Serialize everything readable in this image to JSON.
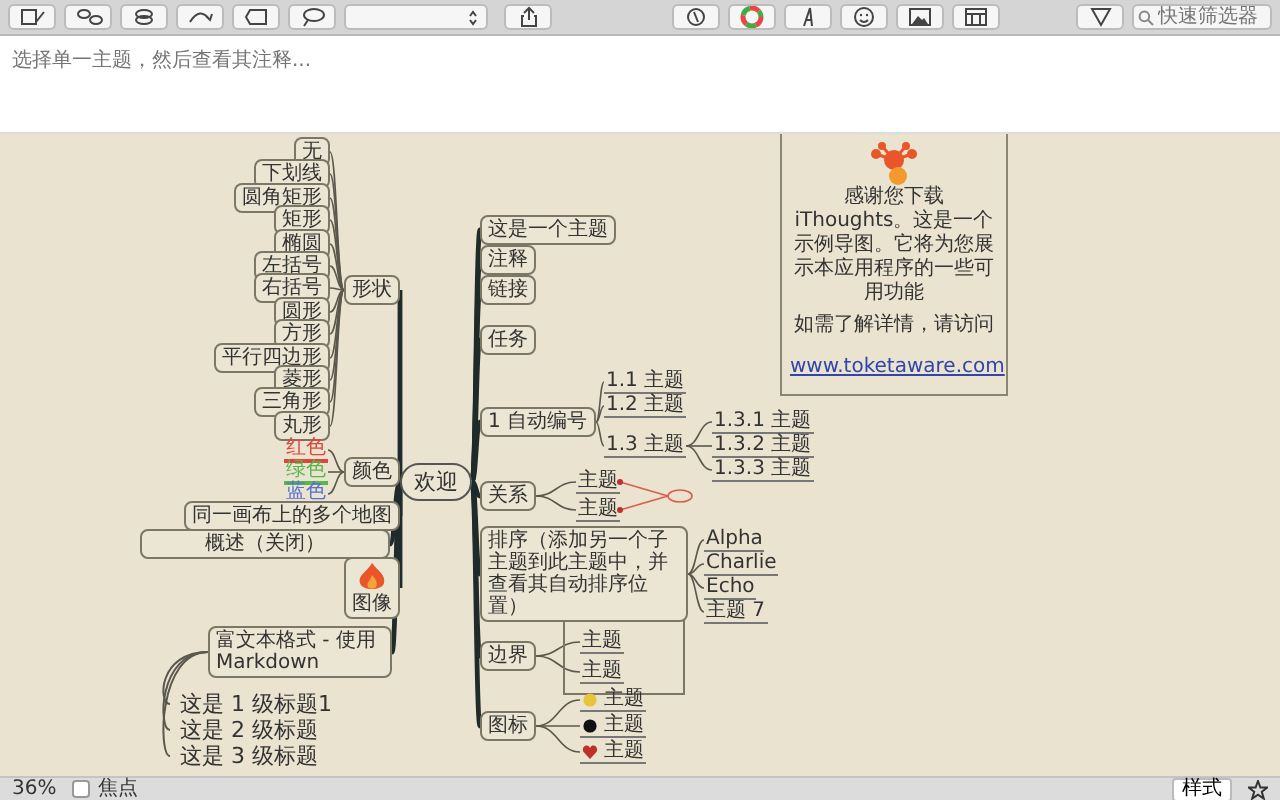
{
  "toolbar": {
    "search": {
      "placeholder": "快速筛选器"
    }
  },
  "notes": {
    "placeholder": "选择单一主题，然后查看其注释..."
  },
  "mindmap": {
    "central": "欢迎",
    "left": [
      {
        "label": "形状",
        "children": [
          {
            "label": "无"
          },
          {
            "label": "下划线"
          },
          {
            "label": "圆角矩形"
          },
          {
            "label": "矩形"
          },
          {
            "label": "椭圆"
          },
          {
            "label": "左括号"
          },
          {
            "label": "右括号"
          },
          {
            "label": "圆形"
          },
          {
            "label": "方形"
          },
          {
            "label": "平行四边形"
          },
          {
            "label": "菱形"
          },
          {
            "label": "三角形"
          },
          {
            "label": "丸形"
          }
        ]
      },
      {
        "label": "颜色",
        "children": [
          {
            "label": "红色",
            "color": "#e0453a"
          },
          {
            "label": "绿色",
            "color": "#56b84a"
          },
          {
            "label": "蓝色",
            "color": "#5a6fd0"
          }
        ]
      },
      {
        "label": "同一画布上的多个地图"
      },
      {
        "label": "概述（关闭）"
      },
      {
        "label": "图像"
      },
      {
        "label": "富文本格式 - 使用 Markdown",
        "children": [
          {
            "label": "这是 1 级标题1"
          },
          {
            "label": "这是 2 级标题"
          },
          {
            "label": "这是 3 级标题"
          }
        ]
      }
    ],
    "right": [
      {
        "label": "这是一个主题"
      },
      {
        "label": "注释"
      },
      {
        "label": "链接"
      },
      {
        "label": "任务"
      },
      {
        "label": "1 自动编号",
        "children": [
          {
            "label": "1.1 主题"
          },
          {
            "label": "1.2 主题"
          },
          {
            "label": "1.3 主题",
            "children": [
              {
                "label": "1.3.1 主题"
              },
              {
                "label": "1.3.2 主题"
              },
              {
                "label": "1.3.3 主题"
              }
            ]
          }
        ]
      },
      {
        "label": "关系",
        "children": [
          {
            "label": "主题"
          },
          {
            "label": "主题"
          }
        ]
      },
      {
        "label": "排序（添加另一个子主题到此主题中，并查看其自动排序位置）",
        "children": [
          {
            "label": "Alpha"
          },
          {
            "label": "Charlie"
          },
          {
            "label": "Echo"
          },
          {
            "label": "主题 7"
          }
        ]
      },
      {
        "label": "边界",
        "children": [
          {
            "label": "主题"
          },
          {
            "label": "主题"
          }
        ]
      },
      {
        "label": "图标",
        "children": [
          {
            "label": "主题"
          },
          {
            "label": "主题"
          },
          {
            "label": "主题"
          }
        ]
      }
    ]
  },
  "welcome_card": {
    "message": "感谢您下载 iThoughts。这是一个示例导图。它将为您展示本应用程序的一些可用功能",
    "more_info": "如需了解详情，请访问",
    "link": "www.toketaware.com"
  },
  "status_bar": {
    "zoom": "36%",
    "focus": {
      "label": "焦点",
      "checked": false
    },
    "style_button": "样式"
  }
}
